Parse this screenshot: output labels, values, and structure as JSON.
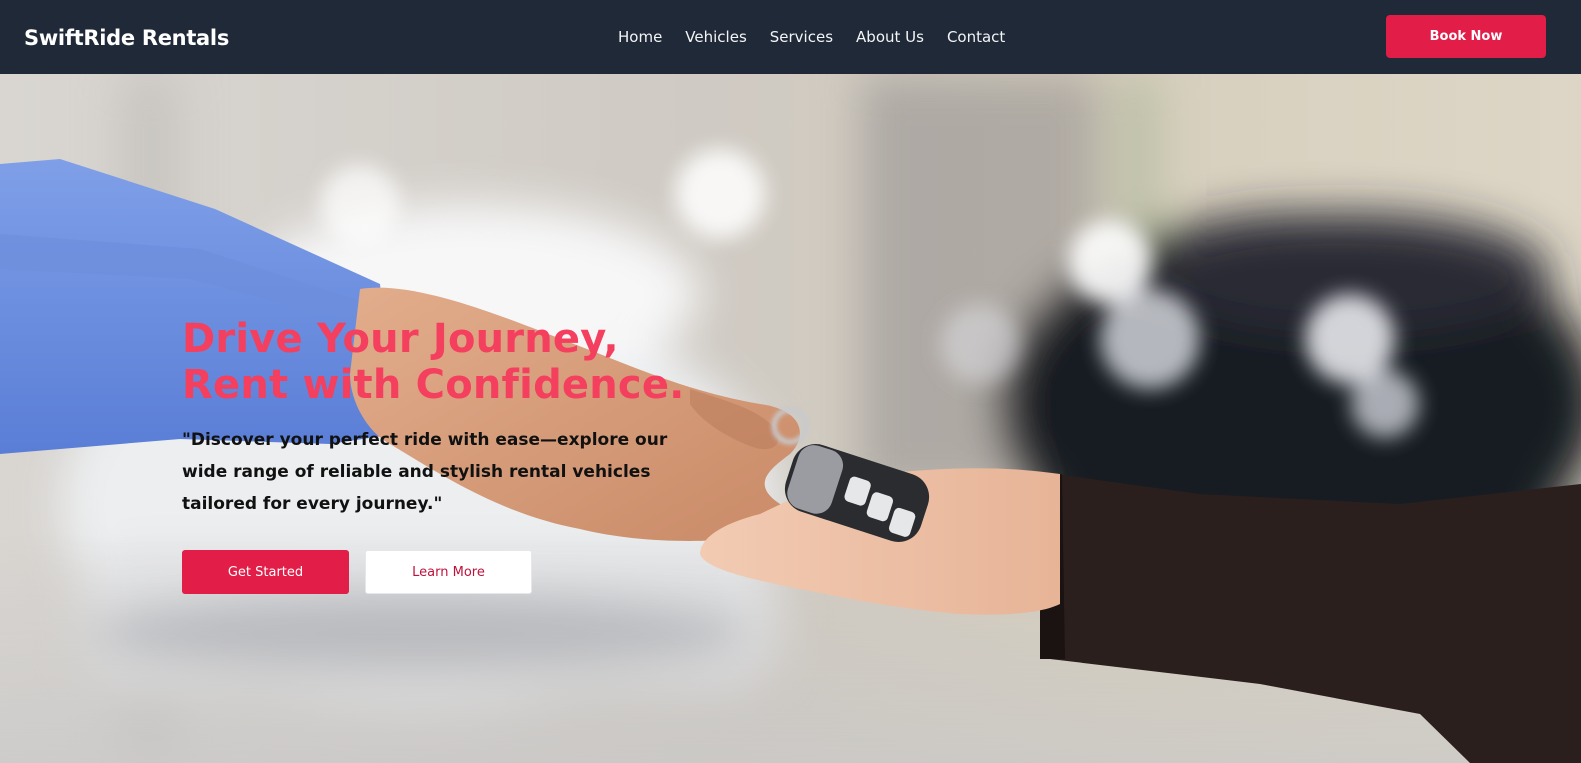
{
  "nav": {
    "brand": "SwiftRide Rentals",
    "links": [
      "Home",
      "Vehicles",
      "Services",
      "About Us",
      "Contact"
    ],
    "book_label": "Book Now"
  },
  "hero": {
    "title": "Drive Your Journey,\nRent with Confidence.",
    "text": "\"Discover your perfect ride with ease—explore our wide range of reliable and stylish rental vehicles tailored for every journey.\"",
    "primary_cta": "Get Started",
    "secondary_cta": "Learn More",
    "background": "hands exchanging car key fob in blurred car showroom"
  },
  "colors": {
    "navbar": "#1f2937",
    "accent": "#e11d48",
    "title": "#f43f5e"
  }
}
